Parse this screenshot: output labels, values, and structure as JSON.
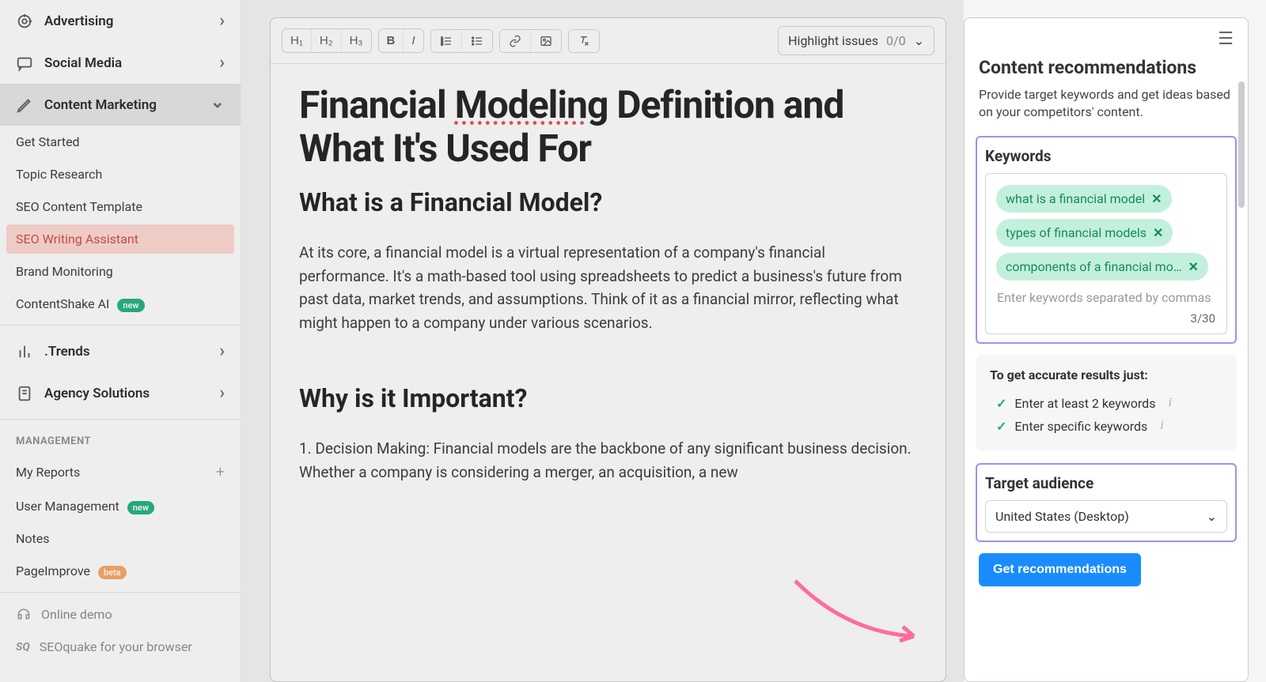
{
  "sidebar": {
    "nav": [
      {
        "label": "Advertising"
      },
      {
        "label": "Social Media"
      },
      {
        "label": "Content Marketing"
      }
    ],
    "content_sub": [
      {
        "label": "Get Started"
      },
      {
        "label": "Topic Research"
      },
      {
        "label": "SEO Content Template"
      },
      {
        "label": "SEO Writing Assistant"
      },
      {
        "label": "Brand Monitoring"
      },
      {
        "label": "ContentShake AI"
      }
    ],
    "trends_label": ".Trends",
    "agency_label": "Agency Solutions",
    "management_label": "MANAGEMENT",
    "management": [
      {
        "label": "My Reports"
      },
      {
        "label": "User Management"
      },
      {
        "label": "Notes"
      },
      {
        "label": "PageImprove"
      }
    ],
    "footer": [
      {
        "label": "Online demo"
      },
      {
        "label": "SEOquake for your browser"
      }
    ],
    "badge_new": "new",
    "badge_beta": "beta"
  },
  "toolbar": {
    "headings": [
      "H₁",
      "H₂",
      "H₃"
    ],
    "issues_label": "Highlight issues",
    "issues_count": "0/0"
  },
  "document": {
    "title_pre": "Financial ",
    "title_mis": "Modeling",
    "title_post": " Definition and What It's Used For",
    "h2a": "What is a Financial Model?",
    "p1": "At its core, a financial model is a virtual representation of a company's financial performance. It's a math-based tool using spreadsheets to predict a business's future from past data, market trends, and assumptions. Think of it as a financial mirror, reflecting what might happen to a company under various scenarios.",
    "h2b": "Why is it Important?",
    "p2": "1. Decision Making: Financial models are the backbone of any significant business decision. Whether a company is considering a merger, an acquisition, a new"
  },
  "panel": {
    "title": "Content recommendations",
    "desc": "Provide target keywords and get ideas based on your competitors' content.",
    "keywords_label": "Keywords",
    "keywords": [
      "what is a financial model",
      "types of financial models",
      "components of a financial mo…"
    ],
    "kw_placeholder": "Enter keywords separated by commas",
    "kw_count": "3/30",
    "tips_title": "To get accurate results just:",
    "tips": [
      "Enter at least 2 keywords",
      "Enter specific keywords"
    ],
    "ta_label": "Target audience",
    "ta_value": "United States (Desktop)",
    "button": "Get recommendations"
  }
}
